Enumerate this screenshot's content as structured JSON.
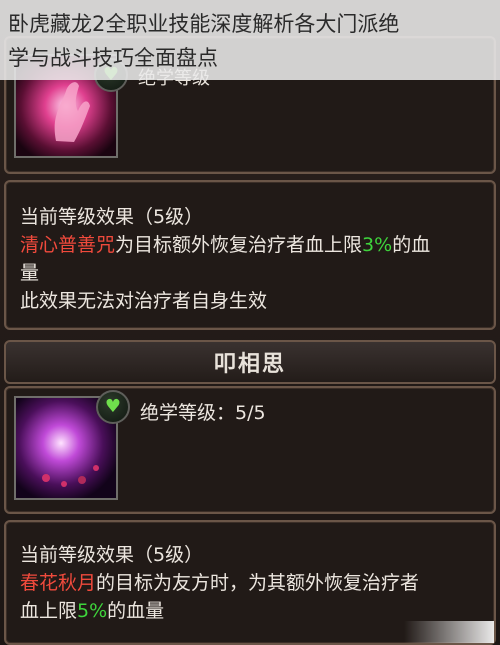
{
  "article_title": {
    "line1": "卧虎藏龙2全职业技能深度解析各大门派绝",
    "line2": "学与战斗技巧全面盘点"
  },
  "skill1": {
    "header_partial": "绝学等级",
    "effect_header": "当前等级效果（5级）",
    "skill_name": "清心普善咒",
    "desc_a": "为目标额外恢复治疗者血上限",
    "percent": "3%",
    "desc_b": "的血",
    "desc_c": "量",
    "desc_d": "此效果无法对治疗者自身生效"
  },
  "skill2": {
    "title": "叩相思",
    "level_label": "绝学等级：5/5",
    "effect_header": "当前等级效果（5级）",
    "skill_name": "春花秋月",
    "desc_a": "的目标为友方时，为其额外恢复治疗者",
    "desc_b": "血上限",
    "percent": "5%",
    "desc_c": "的血量"
  },
  "colors": {
    "highlight_red": "#f04a3c",
    "highlight_green": "#3ed43c",
    "border": "#6b5648"
  },
  "icons": {
    "skill1_icon": "pink-hand-icon",
    "skill2_icon": "purple-orb-icon",
    "badge": "green-heart-icon"
  }
}
